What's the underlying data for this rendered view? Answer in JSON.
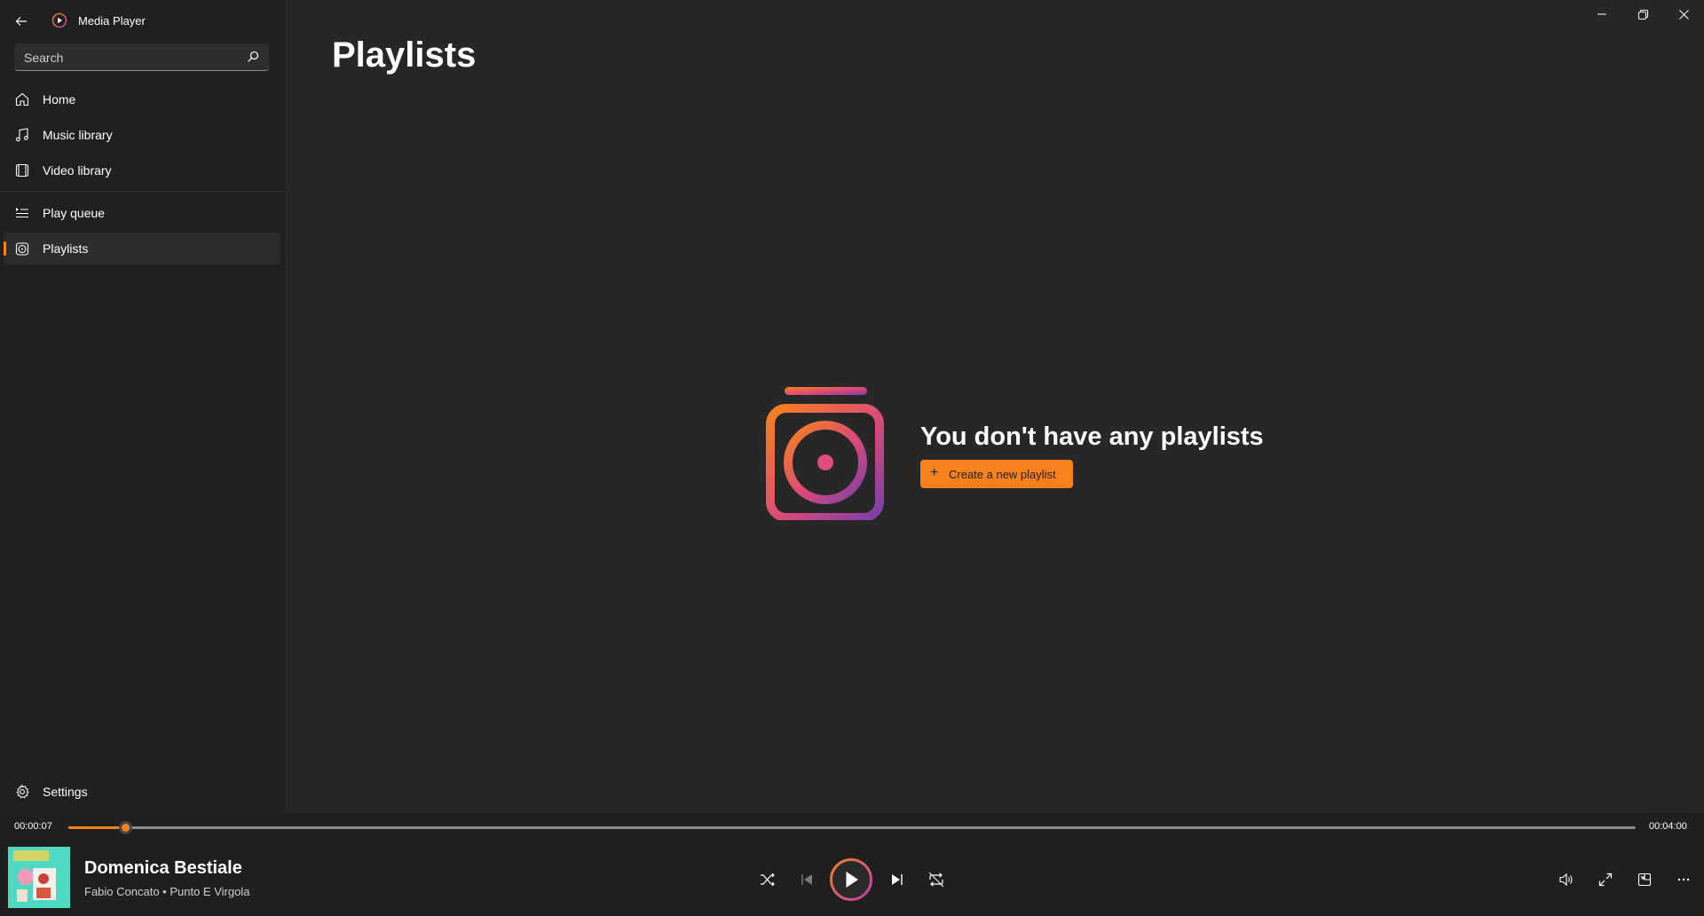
{
  "app": {
    "title": "Media Player"
  },
  "search": {
    "placeholder": "Search"
  },
  "nav": {
    "top": [
      {
        "label": "Home",
        "icon": "home-icon"
      },
      {
        "label": "Music library",
        "icon": "music-note-icon"
      },
      {
        "label": "Video library",
        "icon": "video-library-icon"
      }
    ],
    "bottom": [
      {
        "label": "Play queue",
        "icon": "play-queue-icon"
      },
      {
        "label": "Playlists",
        "icon": "playlist-icon",
        "selected": true
      }
    ],
    "settings_label": "Settings"
  },
  "page": {
    "title": "Playlists",
    "empty_message": "You don't have any playlists",
    "create_button": "Create a new playlist"
  },
  "player": {
    "current_time": "00:00:07",
    "total_time": "00:04:00",
    "progress_fraction": 0.036,
    "song_title": "Domenica Bestiale",
    "song_artist": "Fabio Concato • Punto E Virgola"
  },
  "colors": {
    "accent": "#f7821b",
    "background": "#272727",
    "sidebar": "#202020",
    "player_bar": "#1f1f1f"
  }
}
